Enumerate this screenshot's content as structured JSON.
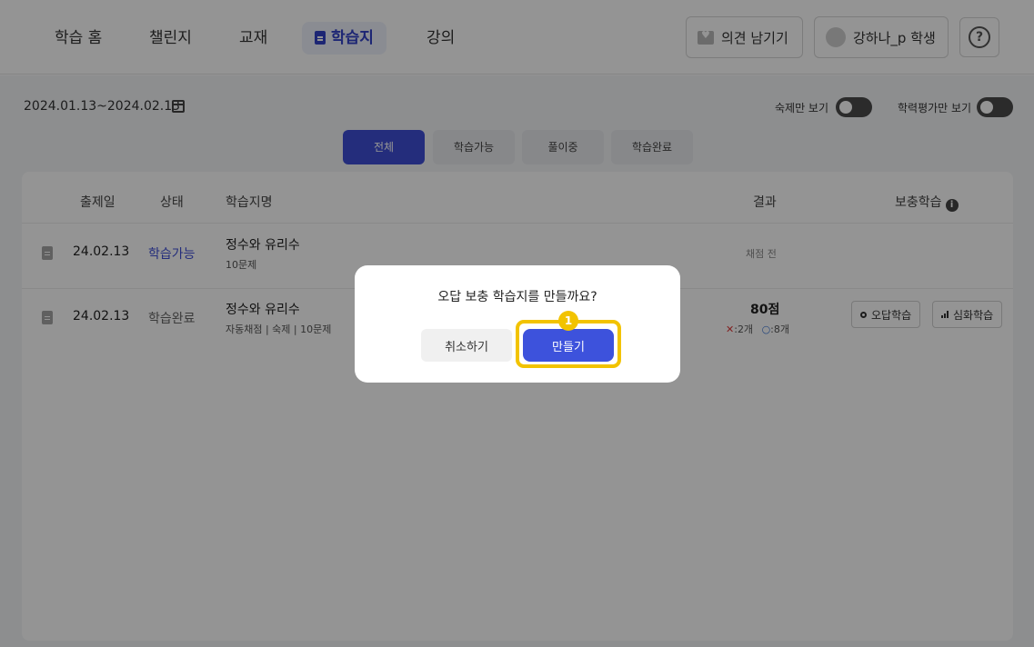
{
  "nav": {
    "items": [
      {
        "label": "학습 홈"
      },
      {
        "label": "챌린지"
      },
      {
        "label": "교재"
      },
      {
        "label": "학습지"
      },
      {
        "label": "강의"
      }
    ],
    "active_index": 3
  },
  "header": {
    "feedback_label": "의견 남기기",
    "user_label": "강하나_p 학생",
    "help_label": "?"
  },
  "filters": {
    "date_range": "2024.01.13~2024.02.13",
    "homework_only_label": "숙제만 보기",
    "assessment_only_label": "학력평가만 보기",
    "homework_only_on": false,
    "assessment_only_on": false
  },
  "tabs": [
    {
      "label": "전체",
      "active": true
    },
    {
      "label": "학습가능",
      "active": false
    },
    {
      "label": "풀이중",
      "active": false
    },
    {
      "label": "학습완료",
      "active": false
    }
  ],
  "table": {
    "headers": {
      "date": "출제일",
      "status": "상태",
      "name": "학습지명",
      "result": "결과",
      "supplement": "보충학습"
    },
    "rows": [
      {
        "date": "24.02.13",
        "status": "학습가능",
        "name": "정수와 유리수",
        "meta": "10문제",
        "result": "채점 전"
      },
      {
        "date": "24.02.13",
        "status": "학습완료",
        "name": "정수와 유리수",
        "meta": "자동채점 | 숙제 | 10문제",
        "result": "80점",
        "wrong": "2개",
        "correct": "8개",
        "actions": [
          "오답학습",
          "심화학습"
        ]
      }
    ]
  },
  "dialog": {
    "title": "오답 보충 학습지를 만들까요?",
    "cancel_label": "취소하기",
    "confirm_label": "만들기",
    "step_badge": "1"
  },
  "colors": {
    "accent": "#3d52dc",
    "highlight": "#f2c300",
    "wrong": "#e03a3a",
    "correct": "#3e78d6"
  }
}
